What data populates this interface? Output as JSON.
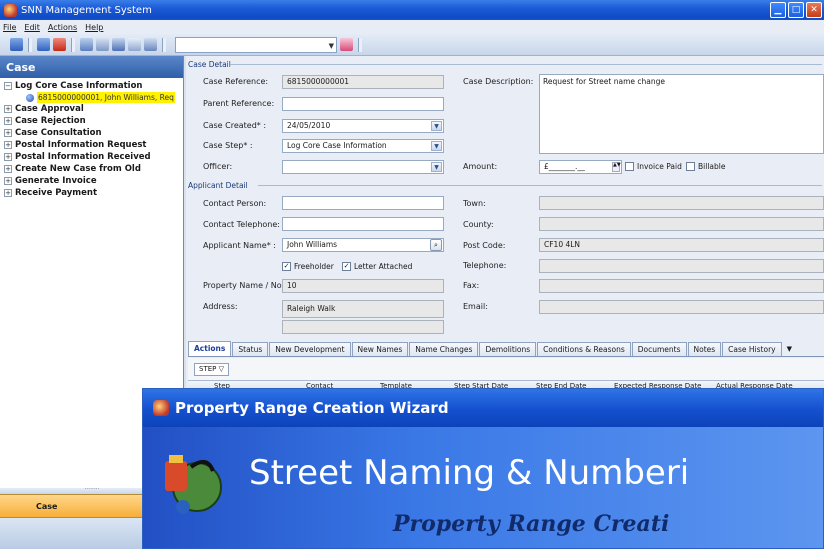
{
  "window": {
    "title": "SNN Management System"
  },
  "menu": [
    "File",
    "Edit",
    "Actions",
    "Help"
  ],
  "nav": {
    "header": "Case",
    "items": [
      {
        "label": "Log Core Case Information",
        "expanded": true
      },
      {
        "label": "Case Approval"
      },
      {
        "label": "Case Rejection"
      },
      {
        "label": "Case Consultation"
      },
      {
        "label": "Postal Information Request"
      },
      {
        "label": "Postal Information Received"
      },
      {
        "label": "Create New Case from Old"
      },
      {
        "label": "Generate Invoice"
      },
      {
        "label": "Receive Payment"
      }
    ],
    "selected_case": "6815000000001, John Williams, Req",
    "bottom_button": "Case"
  },
  "case_detail": {
    "section": "Case Detail",
    "case_reference_label": "Case Reference:",
    "case_reference": "6815000000001",
    "parent_reference_label": "Parent Reference:",
    "parent_reference": "",
    "case_created_label": "Case Created* :",
    "case_created": "24/05/2010",
    "case_step_label": "Case Step* :",
    "case_step": "Log Core Case Information",
    "officer_label": "Officer:",
    "officer": "",
    "case_description_label": "Case Description:",
    "case_description": "Request for Street name change",
    "amount_label": "Amount:",
    "amount": "£_______.__",
    "invoice_paid_label": "Invoice Paid",
    "billable_label": "Billable"
  },
  "applicant": {
    "section": "Applicant Detail",
    "contact_person_label": "Contact Person:",
    "contact_telephone_label": "Contact Telephone:",
    "applicant_name_label": "Applicant Name* :",
    "applicant_name": "John Williams",
    "freeholder_label": "Freeholder",
    "letter_attached_label": "Letter Attached",
    "property_label": "Property Name / No.:",
    "property": "10",
    "address_label": "Address:",
    "address": "Raleigh Walk",
    "town_label": "Town:",
    "county_label": "County:",
    "postcode_label": "Post Code:",
    "postcode": "CF10 4LN",
    "telephone_label": "Telephone:",
    "fax_label": "Fax:",
    "email_label": "Email:"
  },
  "tabs": [
    "Actions",
    "Status",
    "New Development",
    "New Names",
    "Name Changes",
    "Demolitions",
    "Conditions & Reasons",
    "Documents",
    "Notes",
    "Case History"
  ],
  "grid": {
    "group_chip": "STEP",
    "columns": [
      "Step",
      "Contact",
      "Template",
      "Step Start Date",
      "Step End Date",
      "Expected Response Date",
      "Actual Response Date"
    ]
  },
  "wizard": {
    "title": "Property Range Creation Wizard",
    "heading": "Street Naming & Numberi",
    "subheading": "Property Range Creati"
  }
}
